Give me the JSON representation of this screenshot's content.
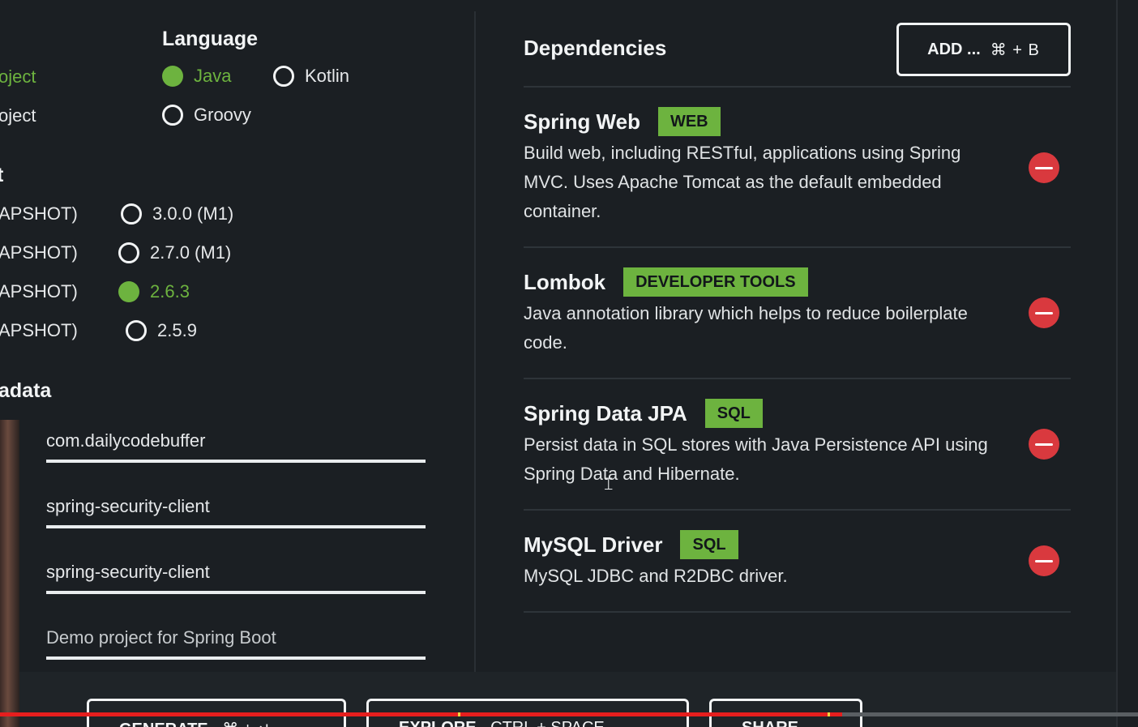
{
  "project": {
    "options": [
      "oject",
      "oject"
    ],
    "selected_index": 0
  },
  "language": {
    "heading": "Language",
    "options": [
      "Java",
      "Kotlin",
      "Groovy"
    ],
    "selected": "Java"
  },
  "spring_boot": {
    "heading_fragment": "t",
    "snapshot_labels": [
      "APSHOT)",
      "APSHOT)",
      "APSHOT)",
      "APSHOT)"
    ],
    "versions": [
      "3.0.0 (M1)",
      "2.7.0 (M1)",
      "2.6.3",
      "2.5.9"
    ],
    "selected": "2.6.3"
  },
  "metadata": {
    "heading_fragment": "adata",
    "group": "com.dailycodebuffer",
    "artifact": "spring-security-client",
    "name": "spring-security-client",
    "description": "Demo project for Spring Boot"
  },
  "dependencies": {
    "title": "Dependencies",
    "add_button": {
      "label": "ADD ...",
      "shortcut": "⌘ + B"
    },
    "items": [
      {
        "name": "Spring Web",
        "badge": "WEB",
        "description": "Build web, including RESTful, applications using Spring MVC. Uses Apache Tomcat as the default embedded container."
      },
      {
        "name": "Lombok",
        "badge": "DEVELOPER TOOLS",
        "description": "Java annotation library which helps to reduce boilerplate code."
      },
      {
        "name": "Spring Data JPA",
        "badge": "SQL",
        "description": "Persist data in SQL stores with Java Persistence API using Spring Data and Hibernate."
      },
      {
        "name": "MySQL Driver",
        "badge": "SQL",
        "description": "MySQL JDBC and R2DBC driver."
      }
    ]
  },
  "footer": {
    "generate": {
      "label": "GENERATE",
      "shortcut": "⌘ + ↵"
    },
    "explore": {
      "label": "EXPLORE",
      "shortcut": "CTRL + SPACE"
    },
    "share": {
      "label": "SHARE..."
    }
  },
  "video_progress": 0.74,
  "colors": {
    "accent": "#6db33f",
    "remove": "#d9393e",
    "background": "#1b1f23",
    "progress": "#e61e1e"
  }
}
